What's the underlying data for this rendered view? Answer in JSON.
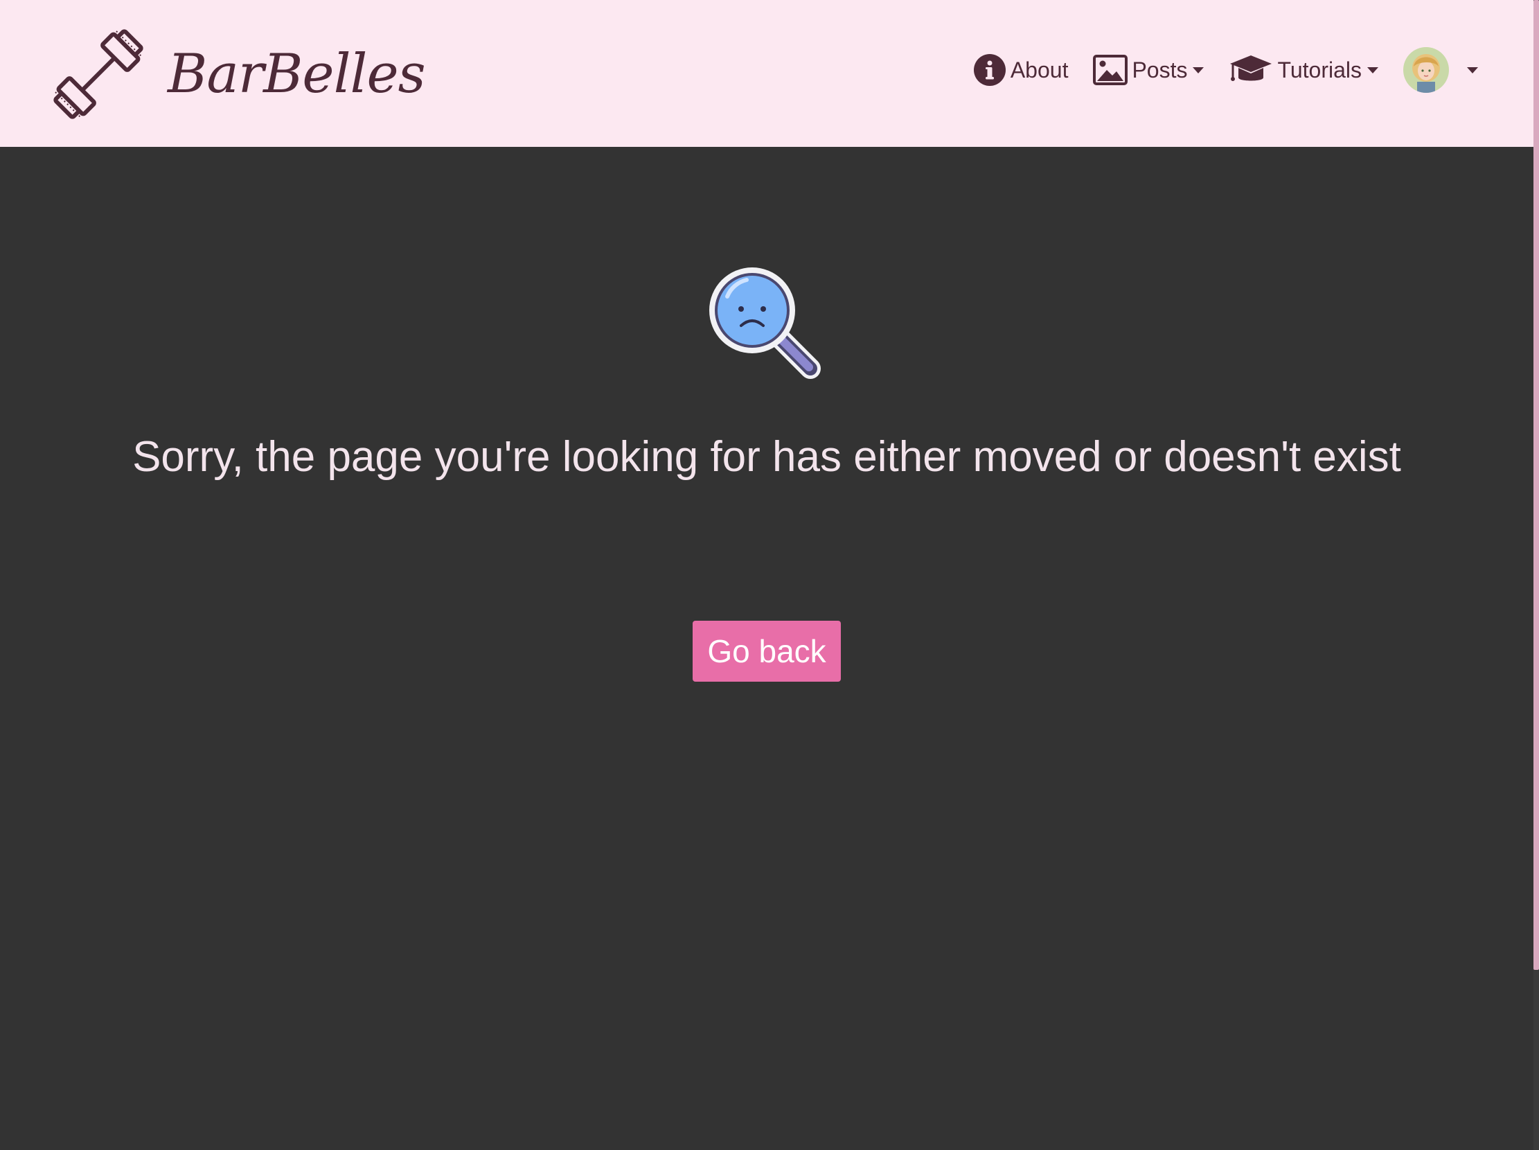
{
  "brand": {
    "name": "BarBelles"
  },
  "nav": {
    "about_label": "About",
    "posts_label": "Posts",
    "tutorials_label": "Tutorials",
    "about_icon": "info-circle-icon",
    "posts_icon": "image-icon",
    "tutorials_icon": "graduation-cap-icon"
  },
  "main": {
    "message": "Sorry, the page you're looking for has either moved or doesn't exist",
    "go_back_label": "Go back",
    "icon": "sad-magnifier-icon"
  },
  "colors": {
    "navbar_bg": "#fce8f1",
    "page_bg": "#333333",
    "text_dark": "#4d2a38",
    "accent": "#e86ea8",
    "message_text": "#f3e4ec"
  }
}
